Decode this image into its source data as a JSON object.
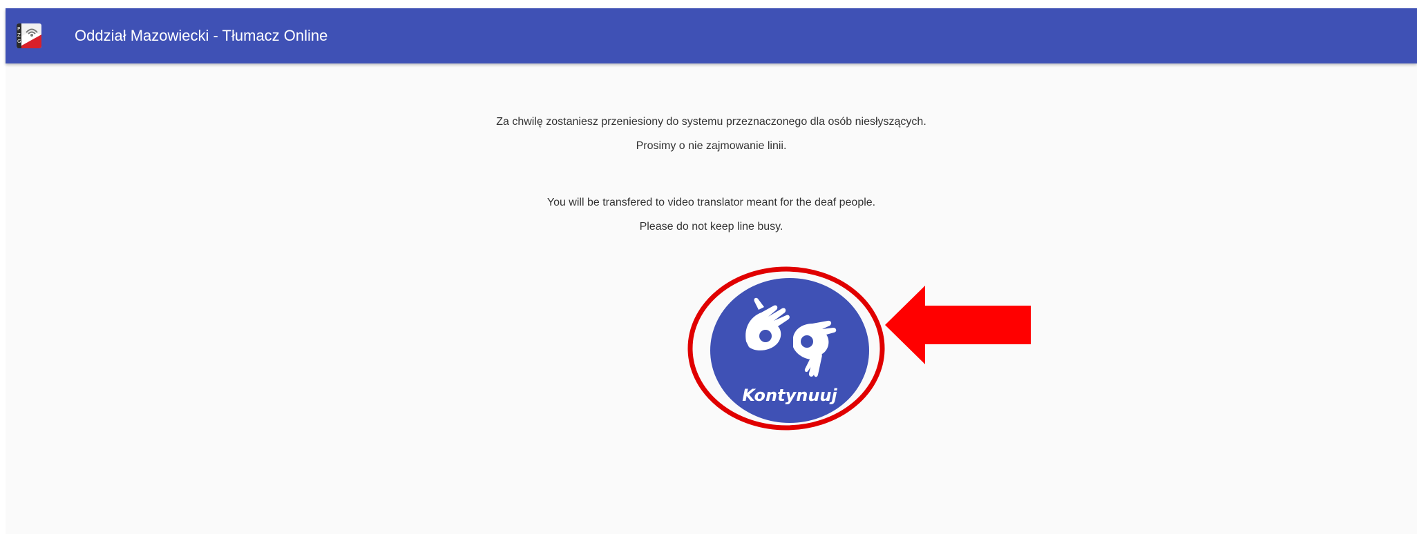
{
  "header": {
    "title": "Oddział Mazowiecki - Tłumacz Online",
    "logo_icon": "pzg-logo-icon",
    "color": "#3f51b5"
  },
  "main": {
    "polish_line_1": "Za chwilę zostaniesz przeniesiony do systemu przeznaczonego dla osób niesłyszących.",
    "polish_line_2": "Prosimy o nie zajmowanie linii.",
    "english_line_1": "You will be transfered to video translator meant for the deaf people.",
    "english_line_2": "Please do not keep line busy."
  },
  "continue_button": {
    "label": "Kontynuuj",
    "icon": "sign-language-hands-icon",
    "color": "#3f51b5"
  },
  "annotation": {
    "ring_color": "#e00000",
    "arrow_color": "#ff0000",
    "arrow_icon": "left-arrow-icon"
  }
}
